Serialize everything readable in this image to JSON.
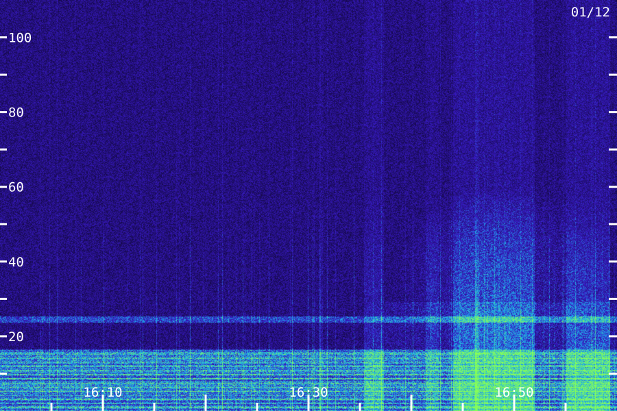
{
  "chart_data": {
    "type": "heatmap",
    "title": "",
    "xlabel": "",
    "ylabel": "",
    "date_label": "01/12",
    "y_ticks": [
      100,
      80,
      60,
      40,
      20
    ],
    "y_minor_ticks": [
      90,
      70,
      50,
      30,
      10
    ],
    "ylim": [
      0,
      110
    ],
    "x_ticks": [
      "16:10",
      "16:30",
      "16:50"
    ],
    "xlim": [
      "16:00",
      "17:00"
    ],
    "colors": {
      "background": "#1a0a5c",
      "noise": "#3a1cc8",
      "signal": "#20e0e0",
      "strong": "#80ff60",
      "text": "#ffffff"
    }
  }
}
